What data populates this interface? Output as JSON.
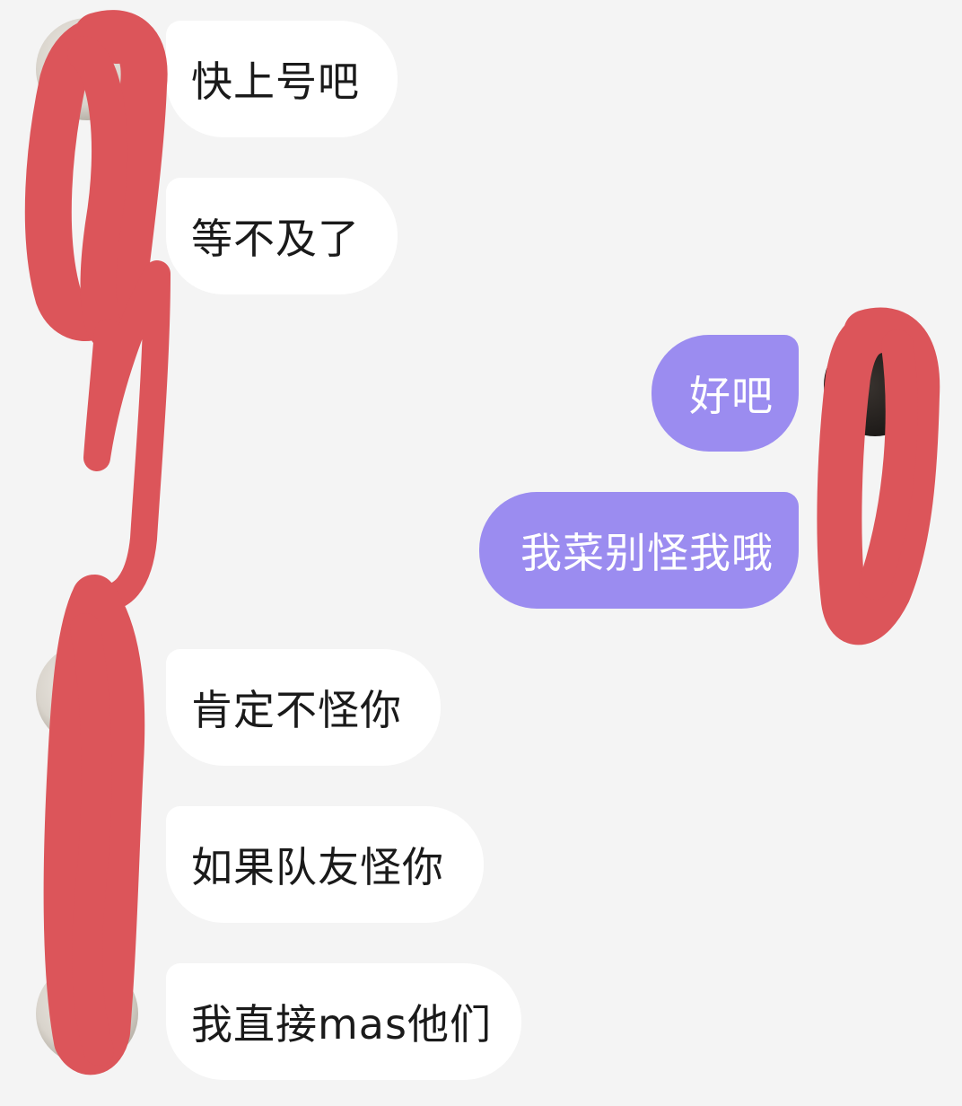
{
  "messages": [
    {
      "side": "incoming",
      "text": "快上号吧"
    },
    {
      "side": "incoming",
      "text": "等不及了"
    },
    {
      "side": "outgoing",
      "text": "好吧"
    },
    {
      "side": "outgoing",
      "text": "我菜别怪我哦"
    },
    {
      "side": "incoming",
      "text": "肯定不怪你"
    },
    {
      "side": "incoming",
      "text": "如果队友怪你"
    },
    {
      "side": "incoming",
      "text": "我直接mas他们"
    }
  ],
  "colors": {
    "background": "#f4f4f4",
    "incoming_bubble": "#ffffff",
    "outgoing_bubble": "#9b8cf0",
    "outgoing_text": "#ffffff",
    "redaction": "#dc555a"
  }
}
